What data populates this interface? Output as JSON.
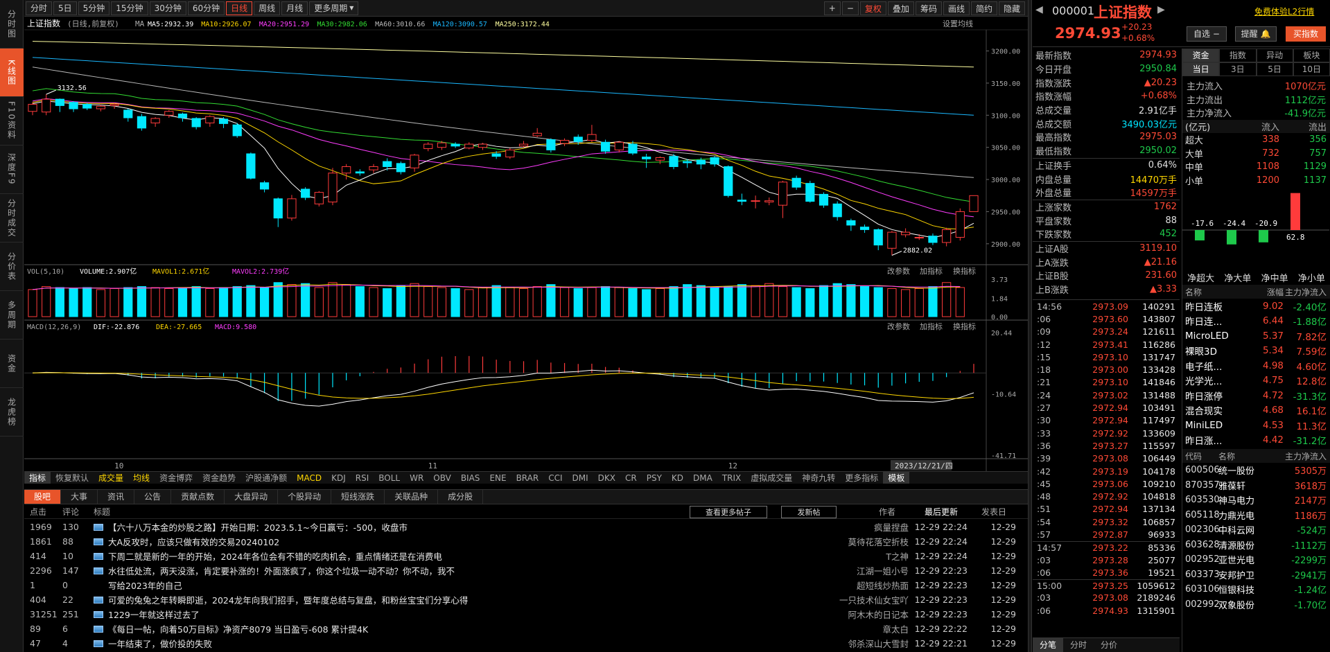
{
  "left_nav": [
    "分时图",
    "K线图",
    "F10资料",
    "深度F9",
    "分时成交",
    "分价表",
    "多周期",
    "资金",
    "龙虎榜"
  ],
  "toolbar": {
    "periods": [
      "分时",
      "5日",
      "5分钟",
      "15分钟",
      "30分钟",
      "60分钟",
      "日线",
      "周线",
      "月线",
      "更多周期"
    ],
    "active": "日线",
    "right": [
      "+",
      "−",
      "复权",
      "叠加",
      "筹码",
      "画线",
      "简约",
      "隐藏"
    ]
  },
  "chart": {
    "title": "上证指数",
    "subtitle": "(日线,前复权)",
    "ma_label": "MA",
    "ma": [
      {
        "label": "MA5:2932.39",
        "color": "#ffffff"
      },
      {
        "label": "MA10:2926.07",
        "color": "#ffd700"
      },
      {
        "label": "MA20:2951.29",
        "color": "#ff3dff"
      },
      {
        "label": "MA30:2982.06",
        "color": "#33dd33"
      },
      {
        "label": "MA60:3010.66",
        "color": "#bbbbbb"
      },
      {
        "label": "MA120:3090.57",
        "color": "#1ab8ff"
      },
      {
        "label": "MA250:3172.44",
        "color": "#ffffa0"
      }
    ],
    "settings": "设置均线",
    "price_ticks": [
      "3200.00",
      "3150.00",
      "3100.00",
      "3050.00",
      "3000.00",
      "2950.00",
      "2900.00"
    ],
    "high_label": "3132.56",
    "low_label": "2882.02",
    "vol_title": "VOL(5,10)",
    "vol_value": "VOLUME:2.907亿",
    "mavol1": "MAVOL1:2.671亿",
    "mavol2": "MAVOL2:2.739亿",
    "vol_ticks": [
      "3.73",
      "1.84",
      "0.00"
    ],
    "panel_btns": [
      "改参数",
      "加指标",
      "换指标"
    ],
    "macd_title": "MACD(12,26,9)",
    "dif": "DIF:-22.876",
    "dea": "DEA:-27.665",
    "macd": "MACD:9.580",
    "macd_ticks": [
      "20.44",
      "-10.64",
      "-41.71"
    ],
    "months": [
      "10",
      "11",
      "12"
    ],
    "date_tag": "2023/12/21/四"
  },
  "ind_tabs": [
    "指标",
    "恢复默认",
    "成交量",
    "均线",
    "资金博弈",
    "资金趋势",
    "沪股通净额",
    "MACD",
    "KDJ",
    "RSI",
    "BOLL",
    "WR",
    "OBV",
    "BIAS",
    "ENE",
    "BRAR",
    "CCI",
    "DMI",
    "DKX",
    "CR",
    "PSY",
    "KD",
    "DMA",
    "TRIX",
    "虚拟成交量",
    "神奇九转",
    "更多指标",
    "模板"
  ],
  "news": {
    "tabs": [
      "股吧",
      "大事",
      "资讯",
      "公告",
      "贡献点数",
      "大盘异动",
      "个股异动",
      "短线涨跌",
      "关联品种",
      "成分股"
    ],
    "head": {
      "c1": "点击",
      "c2": "评论",
      "title": "标题",
      "more": "查看更多帖子",
      "post": "发新帖",
      "author": "作者",
      "updated": "最后更新",
      "posted": "发表日"
    },
    "rows": [
      {
        "c": "1969",
        "r": "130",
        "t": "【六十八万本金的炒股之路】开始日期：2023.5.1~今日赢亏：-500，收盘市",
        "a": "疯量捏盘",
        "u": "12-29  22:24",
        "d": "12-29",
        "icon": true
      },
      {
        "c": "1861",
        "r": "88",
        "t": "大A反攻时，应该只做有效的交易20240102",
        "a": "莫待花落空折枝",
        "u": "12-29  22:24",
        "d": "12-29",
        "icon": true
      },
      {
        "c": "414",
        "r": "10",
        "t": "下周二就是新的一年的开始，2024年各位会有不错的吃肉机会，重点情绪还是在消费电",
        "a": "T之神",
        "u": "12-29  22:24",
        "d": "12-29",
        "icon": true
      },
      {
        "c": "2296",
        "r": "147",
        "t": "水往低处流，两天没涨，肯定要补涨的！外面涨疯了，你这个垃圾一动不动？你不动，我不",
        "a": "江湖一姐小号",
        "u": "12-29  22:23",
        "d": "12-29",
        "icon": true
      },
      {
        "c": "1",
        "r": "0",
        "t": "写给2023年的自己",
        "a": "超短线炒热面",
        "u": "12-29  22:23",
        "d": "12-29",
        "icon": false
      },
      {
        "c": "404",
        "r": "22",
        "t": "可爱的兔兔之年转瞬即逝，2024龙年向我们招手，暨年度总结与复盘，和粉丝宝宝们分享心得",
        "a": "一只技术仙女宝吖",
        "u": "12-29  22:23",
        "d": "12-29",
        "icon": true
      },
      {
        "c": "31251",
        "r": "251",
        "t": "1229一年就这样过去了",
        "a": "阿木木的日记本",
        "u": "12-29  22:23",
        "d": "12-29",
        "icon": true
      },
      {
        "c": "89",
        "r": "6",
        "t": "《每日一帖，向着50万目标》净资产8079 当日盈亏-608 累计提4K",
        "a": "章太白",
        "u": "12-29  22:22",
        "d": "12-29",
        "icon": true
      },
      {
        "c": "47",
        "r": "4",
        "t": "一年结束了，做价投的失败",
        "a": "邻杀深山大雪封",
        "u": "12-29  22:21",
        "d": "12-29",
        "icon": true
      }
    ]
  },
  "right": {
    "code": "000001",
    "name": "上证指数",
    "promo": "免费体验L2行情",
    "price": "2974.93",
    "change": "+20.23",
    "pct": "+0.68%",
    "btns": [
      "自选",
      "提醒",
      "买指数"
    ],
    "quote": [
      {
        "l": "最新指数",
        "v": "2974.93",
        "c": "r"
      },
      {
        "l": "今日开盘",
        "v": "2950.84",
        "c": "g"
      },
      {
        "l": "指数涨跌",
        "v": "▲20.23",
        "c": "r"
      },
      {
        "l": "指数涨幅",
        "v": "+0.68%",
        "c": "r"
      },
      {
        "l": "总成交量",
        "v": "2.91亿手",
        "c": "w"
      },
      {
        "l": "总成交额",
        "v": "3490.03亿元",
        "c": "c"
      },
      {
        "l": "最高指数",
        "v": "2975.03",
        "c": "r"
      },
      {
        "l": "最低指数",
        "v": "2950.02",
        "c": "g"
      }
    ],
    "quote2": [
      {
        "l": "上证换手",
        "v": "0.64%",
        "c": "w"
      },
      {
        "l": "内盘总量",
        "v": "14470万手",
        "c": "y"
      },
      {
        "l": "外盘总量",
        "v": "14597万手",
        "c": "r"
      }
    ],
    "quote3": [
      {
        "l": "上涨家数",
        "v": "1762",
        "c": "r"
      },
      {
        "l": "平盘家数",
        "v": "88",
        "c": "w"
      },
      {
        "l": "下跌家数",
        "v": "452",
        "c": "g"
      }
    ],
    "quote4": [
      {
        "l": "上证A股",
        "v": "3119.10",
        "c": "r"
      },
      {
        "l": "上A涨跌",
        "v": "▲21.16",
        "c": "r"
      },
      {
        "l": "上证B股",
        "v": "231.60",
        "c": "r"
      },
      {
        "l": "上B涨跌",
        "v": "▲3.33",
        "c": "r"
      }
    ],
    "ticks": [
      {
        "t": "14:56",
        "p": "2973.09",
        "v": "140291"
      },
      {
        "t": ":06",
        "p": "2973.60",
        "v": "143807"
      },
      {
        "t": ":09",
        "p": "2973.24",
        "v": "121611"
      },
      {
        "t": ":12",
        "p": "2973.41",
        "v": "116286"
      },
      {
        "t": ":15",
        "p": "2973.10",
        "v": "131747"
      },
      {
        "t": ":18",
        "p": "2973.00",
        "v": "133428"
      },
      {
        "t": ":21",
        "p": "2973.10",
        "v": "141846"
      },
      {
        "t": ":24",
        "p": "2973.02",
        "v": "131488"
      },
      {
        "t": ":27",
        "p": "2972.94",
        "v": "103491"
      },
      {
        "t": ":30",
        "p": "2972.94",
        "v": "117497"
      },
      {
        "t": ":33",
        "p": "2972.92",
        "v": "133609"
      },
      {
        "t": ":36",
        "p": "2973.27",
        "v": "115597"
      },
      {
        "t": ":39",
        "p": "2973.08",
        "v": "106449"
      },
      {
        "t": ":42",
        "p": "2973.19",
        "v": "104178"
      },
      {
        "t": ":45",
        "p": "2973.06",
        "v": "109210"
      },
      {
        "t": ":48",
        "p": "2972.92",
        "v": "104818"
      },
      {
        "t": ":51",
        "p": "2972.94",
        "v": "137134"
      },
      {
        "t": ":54",
        "p": "2973.32",
        "v": "106857"
      },
      {
        "t": ":57",
        "p": "2972.87",
        "v": "96933"
      },
      {
        "t": "14:57",
        "p": "2973.22",
        "v": "85336"
      },
      {
        "t": ":03",
        "p": "2973.28",
        "v": "25077"
      },
      {
        "t": ":06",
        "p": "2973.36",
        "v": "19521"
      },
      {
        "t": "15:00",
        "p": "2973.25",
        "v": "1059612"
      },
      {
        "t": ":03",
        "p": "2973.08",
        "v": "2189246"
      },
      {
        "t": ":06",
        "p": "2974.93",
        "v": "1315901"
      }
    ],
    "bottom_tabs": [
      "分笔",
      "分时",
      "分价"
    ],
    "fund_tabs": [
      "资金",
      "指数",
      "异动",
      "板块"
    ],
    "fund_subtabs": [
      "当日",
      "3日",
      "5日",
      "10日"
    ],
    "flows": [
      {
        "l": "主力流入",
        "v": "1070亿元",
        "c": "r"
      },
      {
        "l": "主力流出",
        "v": "1112亿元",
        "c": "g"
      },
      {
        "l": "主力净流入",
        "v": "-41.9亿元",
        "c": "g"
      }
    ],
    "flow_head": [
      "(亿元)",
      "流入",
      "流出"
    ],
    "flow_table": [
      [
        "超大",
        "338",
        "356"
      ],
      [
        "大单",
        "732",
        "757"
      ],
      [
        "中单",
        "1108",
        "1129"
      ],
      [
        "小单",
        "1200",
        "1137"
      ]
    ],
    "net_bars": [
      {
        "label": "-17.6",
        "v": -17.6
      },
      {
        "label": "-24.4",
        "v": -24.4
      },
      {
        "label": "-20.9",
        "v": -20.9
      },
      {
        "label": "62.8",
        "v": 62.8
      }
    ],
    "net_names": [
      "净超大",
      "净大单",
      "净中单",
      "净小单"
    ],
    "sector_head": [
      "名称",
      "涨幅",
      "主力净流入"
    ],
    "sectors": [
      {
        "n": "昨日连板",
        "p": "9.02",
        "f": "-2.40亿"
      },
      {
        "n": "昨日连...",
        "p": "6.44",
        "f": "-1.88亿"
      },
      {
        "n": "MicroLED",
        "p": "5.37",
        "f": "7.82亿"
      },
      {
        "n": "裸眼3D",
        "p": "5.34",
        "f": "7.59亿"
      },
      {
        "n": "电子纸...",
        "p": "4.98",
        "f": "4.60亿"
      },
      {
        "n": "光学光...",
        "p": "4.75",
        "f": "12.8亿"
      },
      {
        "n": "昨日涨停",
        "p": "4.72",
        "f": "-31.3亿"
      },
      {
        "n": "混合现实",
        "p": "4.68",
        "f": "16.1亿"
      },
      {
        "n": "MiniLED",
        "p": "4.53",
        "f": "11.3亿"
      },
      {
        "n": "昨日涨...",
        "p": "4.42",
        "f": "-31.2亿"
      }
    ],
    "stock_head": [
      "代码",
      "名称",
      "主力净流入"
    ],
    "stocks": [
      {
        "c": "600506",
        "n": "统一股份",
        "v": "5305万"
      },
      {
        "c": "870357",
        "n": "雅葆轩",
        "v": "3618万"
      },
      {
        "c": "603530",
        "n": "神马电力",
        "v": "2147万"
      },
      {
        "c": "605118",
        "n": "力鼎光电",
        "v": "1186万"
      },
      {
        "c": "002306",
        "n": "中科云网",
        "v": "-524万"
      },
      {
        "c": "603628",
        "n": "清源股份",
        "v": "-1112万"
      },
      {
        "c": "002952",
        "n": "亚世光电",
        "v": "-2299万"
      },
      {
        "c": "603373",
        "n": "安邦护卫",
        "v": "-2941万"
      },
      {
        "c": "603106",
        "n": "恒银科技",
        "v": "-1.24亿"
      },
      {
        "c": "002992",
        "n": "双象股份",
        "v": "-1.70亿"
      }
    ]
  },
  "chart_data": {
    "type": "candlestick",
    "ylim": [
      2875,
      3220
    ],
    "candles": [
      {
        "o": 3106,
        "c": 3117,
        "h": 3120,
        "l": 3100
      },
      {
        "o": 3105,
        "c": 3125,
        "h": 3132.56,
        "l": 3100
      },
      {
        "o": 3125,
        "c": 3115,
        "h": 3126,
        "l": 3105
      },
      {
        "o": 3120,
        "c": 3110,
        "h": 3122,
        "l": 3105
      },
      {
        "o": 3117,
        "c": 3111,
        "h": 3119,
        "l": 3108
      },
      {
        "o": 3110,
        "c": 3114,
        "h": 3116,
        "l": 3106
      },
      {
        "o": 3115,
        "c": 3117,
        "h": 3119,
        "l": 3110
      },
      {
        "o": 3108,
        "c": 3096,
        "h": 3110,
        "l": 3090
      },
      {
        "o": 3098,
        "c": 3080,
        "h": 3102,
        "l": 3076
      },
      {
        "o": 3088,
        "c": 3095,
        "h": 3097,
        "l": 3082
      },
      {
        "o": 3100,
        "c": 3106,
        "h": 3108,
        "l": 3096
      },
      {
        "o": 3102,
        "c": 3096,
        "h": 3104,
        "l": 3090
      },
      {
        "o": 3095,
        "c": 3082,
        "h": 3097,
        "l": 3078
      },
      {
        "o": 3088,
        "c": 3098,
        "h": 3100,
        "l": 3082
      },
      {
        "o": 3094,
        "c": 3087,
        "h": 3097,
        "l": 3080
      },
      {
        "o": 3085,
        "c": 3068,
        "h": 3088,
        "l": 3065
      },
      {
        "o": 3040,
        "c": 3002,
        "h": 3042,
        "l": 3000
      },
      {
        "o": 2995,
        "c": 2985,
        "h": 2998,
        "l": 2980
      },
      {
        "o": 2970,
        "c": 2940,
        "h": 2972,
        "l": 2926
      },
      {
        "o": 2940,
        "c": 2970,
        "h": 2976,
        "l": 2936
      },
      {
        "o": 2985,
        "c": 2972,
        "h": 2988,
        "l": 2968
      },
      {
        "o": 2962,
        "c": 2980,
        "h": 2982,
        "l": 2958
      },
      {
        "o": 2965,
        "c": 3010,
        "h": 3018,
        "l": 2960
      },
      {
        "o": 3010,
        "c": 3020,
        "h": 3024,
        "l": 3000
      },
      {
        "o": 3012,
        "c": 3010,
        "h": 3016,
        "l": 3006
      },
      {
        "o": 3015,
        "c": 3020,
        "h": 3024,
        "l": 3010
      },
      {
        "o": 3028,
        "c": 3020,
        "h": 3033,
        "l": 3014
      },
      {
        "o": 3025,
        "c": 3012,
        "h": 3028,
        "l": 3008
      },
      {
        "o": 3018,
        "c": 3038,
        "h": 3040,
        "l": 3012
      },
      {
        "o": 3048,
        "c": 3055,
        "h": 3058,
        "l": 3044
      },
      {
        "o": 3050,
        "c": 3057,
        "h": 3060,
        "l": 3046
      },
      {
        "o": 3055,
        "c": 3052,
        "h": 3058,
        "l": 3049
      },
      {
        "o": 3049,
        "c": 3055,
        "h": 3058,
        "l": 3047
      },
      {
        "o": 3050,
        "c": 3055,
        "h": 3057,
        "l": 3046
      },
      {
        "o": 3040,
        "c": 3036,
        "h": 3044,
        "l": 3032
      },
      {
        "o": 3035,
        "c": 3046,
        "h": 3049,
        "l": 3032
      },
      {
        "o": 3052,
        "c": 3055,
        "h": 3060,
        "l": 3050
      },
      {
        "o": 3068,
        "c": 3072,
        "h": 3080,
        "l": 3066
      },
      {
        "o": 3062,
        "c": 3046,
        "h": 3064,
        "l": 3042
      },
      {
        "o": 3056,
        "c": 3061,
        "h": 3064,
        "l": 3052
      },
      {
        "o": 3066,
        "c": 3059,
        "h": 3070,
        "l": 3054
      },
      {
        "o": 3061,
        "c": 3070,
        "h": 3085,
        "l": 3058
      },
      {
        "o": 3058,
        "c": 3044,
        "h": 3062,
        "l": 3040
      },
      {
        "o": 3046,
        "c": 3058,
        "h": 3060,
        "l": 3042
      },
      {
        "o": 3055,
        "c": 3041,
        "h": 3060,
        "l": 3038
      },
      {
        "o": 3035,
        "c": 3032,
        "h": 3040,
        "l": 3018
      },
      {
        "o": 3030,
        "c": 3034,
        "h": 3036,
        "l": 3024
      },
      {
        "o": 3036,
        "c": 3020,
        "h": 3040,
        "l": 3016
      },
      {
        "o": 3028,
        "c": 3026,
        "h": 3032,
        "l": 3018
      },
      {
        "o": 3030,
        "c": 3024,
        "h": 3034,
        "l": 3016
      },
      {
        "o": 3034,
        "c": 3024,
        "h": 3036,
        "l": 3020
      },
      {
        "o": 3020,
        "c": 2975,
        "h": 3022,
        "l": 2972
      },
      {
        "o": 2968,
        "c": 2966,
        "h": 2978,
        "l": 2960
      },
      {
        "o": 2966,
        "c": 2967,
        "h": 2975,
        "l": 2955
      },
      {
        "o": 2965,
        "c": 2967,
        "h": 2972,
        "l": 2960
      },
      {
        "o": 2960,
        "c": 2996,
        "h": 2998,
        "l": 2940
      },
      {
        "o": 3002,
        "c": 2988,
        "h": 3006,
        "l": 2984
      },
      {
        "o": 2994,
        "c": 2966,
        "h": 2998,
        "l": 2964
      },
      {
        "o": 2977,
        "c": 2960,
        "h": 2980,
        "l": 2956
      },
      {
        "o": 2962,
        "c": 2942,
        "h": 2966,
        "l": 2936
      },
      {
        "o": 2936,
        "c": 2929,
        "h": 2939,
        "l": 2920
      },
      {
        "o": 2926,
        "c": 2922,
        "h": 2930,
        "l": 2917
      },
      {
        "o": 2922,
        "c": 2898,
        "h": 2924,
        "l": 2890
      },
      {
        "o": 2893,
        "c": 2918,
        "h": 2920,
        "l": 2882.02
      },
      {
        "o": 2914,
        "c": 2918,
        "h": 2924,
        "l": 2910
      },
      {
        "o": 2910,
        "c": 2910,
        "h": 2915,
        "l": 2906
      },
      {
        "o": 2912,
        "c": 2902,
        "h": 2916,
        "l": 2898
      },
      {
        "o": 2902,
        "c": 2922,
        "h": 2925,
        "l": 2896
      },
      {
        "o": 2910,
        "c": 2950,
        "h": 2955,
        "l": 2905
      },
      {
        "o": 2950,
        "c": 2974.93,
        "h": 2975.03,
        "l": 2950.02
      }
    ],
    "ma": {
      "MA250": [
        3215,
        3175
      ],
      "MA120": [
        3190,
        3100
      ],
      "MA60": [
        3175,
        3003
      ],
      "MA30": [
        3138,
        2965
      ],
      "MA20": [
        3122,
        2942
      ],
      "MA10": [
        3120,
        2926
      ],
      "MA5": [
        3118,
        2932
      ]
    },
    "volume_ylim": [
      0,
      3.73
    ],
    "volumes": [
      2.7,
      3.0,
      2.9,
      2.8,
      2.9,
      2.7,
      2.8,
      2.9,
      3.0,
      2.9,
      2.8,
      2.9,
      3.0,
      2.8,
      2.9,
      3.0,
      3.1,
      2.9,
      3.4,
      3.2,
      3.3,
      2.9,
      3.4,
      3.2,
      3.0,
      2.9,
      2.8,
      3.1,
      3.3,
      3.0,
      2.9,
      2.8,
      2.7,
      2.9,
      3.1,
      2.9,
      2.8,
      3.0,
      3.2,
      2.9,
      2.8,
      2.9,
      3.0,
      2.9,
      2.8,
      2.7,
      2.8,
      3.0,
      3.2,
      3.1,
      2.9,
      3.0,
      3.2,
      3.1,
      3.3,
      3.0,
      2.9,
      2.8,
      3.1,
      3.3,
      3.2,
      3.0,
      2.9,
      2.8,
      2.7,
      2.8,
      3.0,
      3.4,
      2.907
    ],
    "macd_ylim": [
      -41.71,
      20.44
    ]
  }
}
